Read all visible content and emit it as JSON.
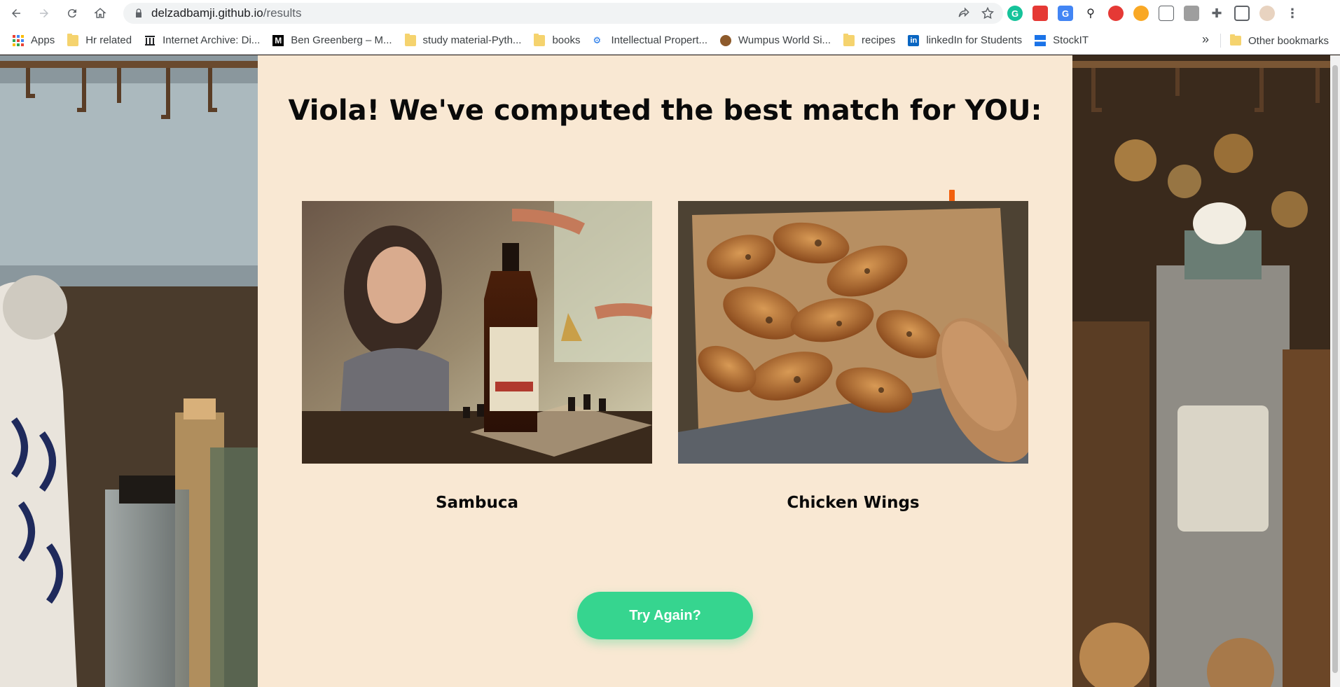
{
  "browser": {
    "url_host": "delzadbamji.github.io",
    "url_path": "/results"
  },
  "bookmarks": [
    {
      "label": "Apps",
      "icon": "apps-grid-icon"
    },
    {
      "label": "Hr related",
      "icon": "folder-icon"
    },
    {
      "label": "Internet Archive: Di...",
      "icon": "archive-icon"
    },
    {
      "label": "Ben Greenberg – M...",
      "icon": "medium-icon"
    },
    {
      "label": "study material-Pyth...",
      "icon": "folder-icon"
    },
    {
      "label": "books",
      "icon": "folder-icon"
    },
    {
      "label": "Intellectual Propert...",
      "icon": "ip-icon"
    },
    {
      "label": "Wumpus World Si...",
      "icon": "wumpus-icon"
    },
    {
      "label": "recipes",
      "icon": "folder-icon"
    },
    {
      "label": "linkedIn for Students",
      "icon": "linkedin-icon"
    },
    {
      "label": "StockIT",
      "icon": "stockit-icon"
    }
  ],
  "bookmarks_more": "»",
  "other_bookmarks": "Other bookmarks",
  "results": {
    "headline": "Viola! We've computed the best match for YOU:",
    "drink": {
      "label": "Sambuca",
      "image": "whiskey bottle with chess board"
    },
    "food": {
      "label": "Chicken Wings",
      "image": "baked chicken wings on tray"
    },
    "try_again_label": "Try Again?"
  },
  "colors": {
    "panel_bg": "#f9e8d3",
    "button_bg": "#36d58f",
    "text": "#0a0a0a"
  }
}
